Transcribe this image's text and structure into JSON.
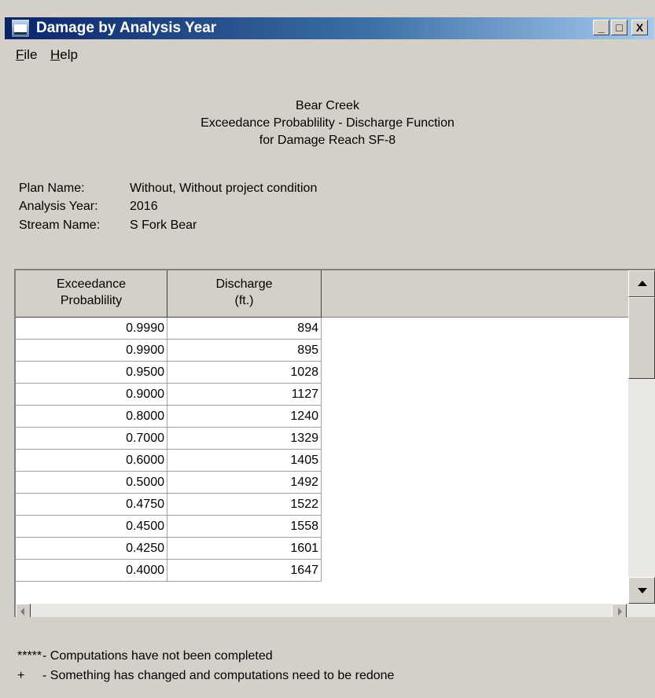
{
  "window": {
    "title": "Damage by Analysis Year",
    "controls": [
      "_",
      "□",
      "X"
    ]
  },
  "menu": [
    {
      "label": "File",
      "hotkey": "F",
      "rest": "ile"
    },
    {
      "label": "Help",
      "hotkey": "H",
      "rest": "elp"
    }
  ],
  "header": {
    "line1": "Bear Creek",
    "line2": "Exceedance Probablility - Discharge Function",
    "line3": "for  Damage Reach SF-8"
  },
  "info": {
    "plan_label": "Plan Name:",
    "plan_value": "Without, Without project condition",
    "year_label": "Analysis Year:",
    "year_value": "2016",
    "stream_label": "Stream Name:",
    "stream_value": "S Fork Bear"
  },
  "table": {
    "columns": [
      {
        "line1": "Exceedance",
        "line2": "Probablility"
      },
      {
        "line1": "Discharge",
        "line2": "(ft.)"
      }
    ],
    "rows": [
      [
        "0.9990",
        "894"
      ],
      [
        "0.9900",
        "895"
      ],
      [
        "0.9500",
        "1028"
      ],
      [
        "0.9000",
        "1127"
      ],
      [
        "0.8000",
        "1240"
      ],
      [
        "0.7000",
        "1329"
      ],
      [
        "0.6000",
        "1405"
      ],
      [
        "0.5000",
        "1492"
      ],
      [
        "0.4750",
        "1522"
      ],
      [
        "0.4500",
        "1558"
      ],
      [
        "0.4250",
        "1601"
      ],
      [
        "0.4000",
        "1647"
      ]
    ]
  },
  "legend": [
    {
      "symbol": "*****",
      "text": "- Computations have not been completed"
    },
    {
      "symbol": "+",
      "text": "- Something has changed and computations need to be redone"
    }
  ]
}
